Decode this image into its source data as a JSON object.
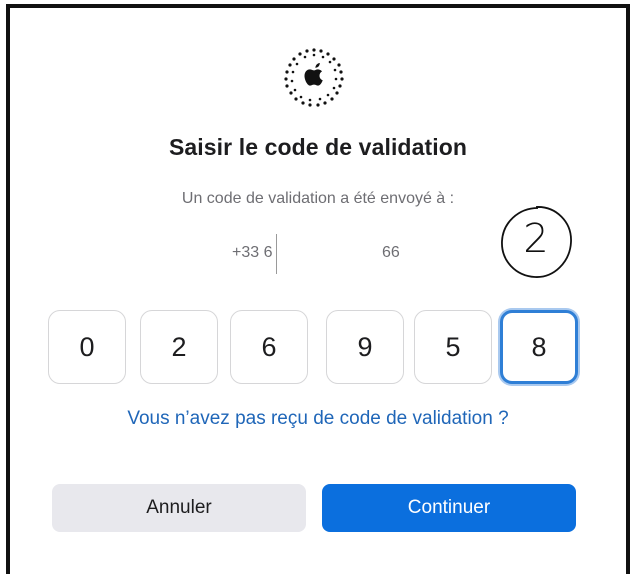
{
  "dialog": {
    "title": "Saisir le code de validation",
    "subtitle": "Un code de validation a été envoyé à :",
    "phone_prefix": "+33 6",
    "phone_suffix": "66",
    "step_number": "2",
    "code_digits": [
      "0",
      "2",
      "6",
      "9",
      "5",
      "8"
    ],
    "resend_link": "Vous n’avez pas reçu de code de validation ?",
    "cancel_label": "Annuler",
    "continue_label": "Continuer"
  },
  "icons": {
    "logo": "apple-logo-icon"
  },
  "colors": {
    "accent": "#0b6fde",
    "link": "#1f66b8",
    "cancel_bg": "#e8e8ed",
    "active_border": "#2f7fd6"
  }
}
